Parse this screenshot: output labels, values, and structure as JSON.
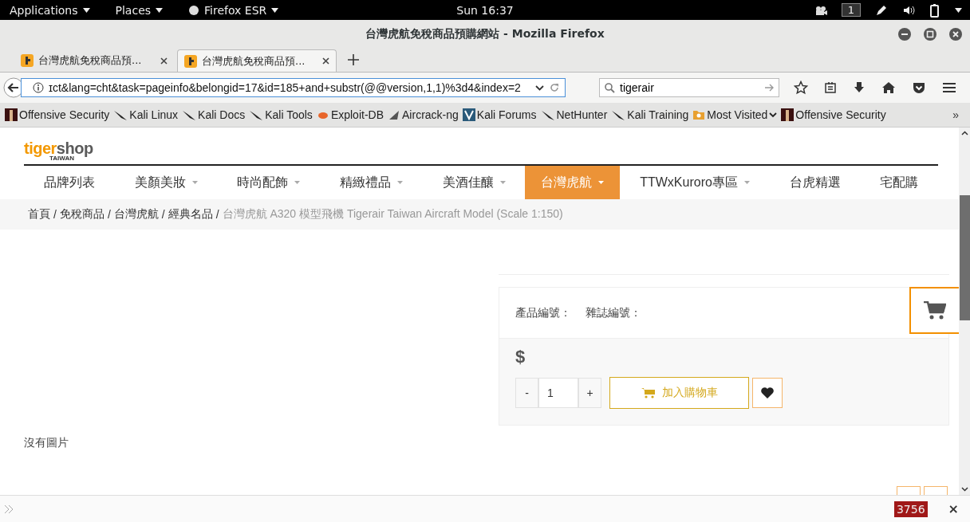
{
  "system_bar": {
    "menus": [
      {
        "label": "Applications",
        "kind": "menu"
      },
      {
        "label": "Places",
        "kind": "menu"
      },
      {
        "label": "Firefox ESR",
        "kind": "app"
      }
    ],
    "clock": "Sun 16:37",
    "workspace": "1"
  },
  "window": {
    "title": "台灣虎航免稅商品預購網站 - Mozilla Firefox"
  },
  "tabs": [
    {
      "label": "台灣虎航免稅商品預...",
      "selected": false
    },
    {
      "label": "台灣虎航免稅商品預...",
      "selected": true
    }
  ],
  "address_bar": {
    "value": "ɪct&lang=cht&task=pageinfo&belongid=17&id=185+and+substr(@@version,1,1)%3d4&index=2"
  },
  "search": {
    "value": "tigerair"
  },
  "bookmarks": [
    {
      "label": "Offensive Security",
      "kind": "offsec"
    },
    {
      "label": "Kali Linux",
      "kind": "kali"
    },
    {
      "label": "Kali Docs",
      "kind": "kali"
    },
    {
      "label": "Kali Tools",
      "kind": "kali"
    },
    {
      "label": "Exploit-DB",
      "kind": "exploit"
    },
    {
      "label": "Aircrack-ng",
      "kind": "aircrack"
    },
    {
      "label": "Kali Forums",
      "kind": "forums"
    },
    {
      "label": "NetHunter",
      "kind": "kali"
    },
    {
      "label": "Kali Training",
      "kind": "kali"
    },
    {
      "label": "Most Visited",
      "kind": "folder"
    },
    {
      "label": "Offensive Security",
      "kind": "offsec"
    }
  ],
  "bookmarks_overflow": "»",
  "site": {
    "logo": {
      "first": "tiger",
      "second": "shop",
      "subtitle": "TAIWAN"
    },
    "nav": [
      {
        "label": "品牌列表",
        "dropdown": false,
        "selected": false
      },
      {
        "label": "美顏美妝",
        "dropdown": true,
        "selected": false
      },
      {
        "label": "時尚配飾",
        "dropdown": true,
        "selected": false
      },
      {
        "label": "精緻禮品",
        "dropdown": true,
        "selected": false
      },
      {
        "label": "美酒佳釀",
        "dropdown": true,
        "selected": false
      },
      {
        "label": "台灣虎航",
        "dropdown": true,
        "selected": true
      },
      {
        "label": "TTWxKuroro專區",
        "dropdown": true,
        "selected": false
      },
      {
        "label": "台虎精選",
        "dropdown": false,
        "selected": false
      },
      {
        "label": "宅配購",
        "dropdown": false,
        "selected": false
      }
    ],
    "breadcrumb": [
      {
        "label": "首頁",
        "separator": "/"
      },
      {
        "label": "免稅商品",
        "separator": "/"
      },
      {
        "label": "台灣虎航",
        "separator": "/"
      },
      {
        "label": "經典名品",
        "separator": "/"
      },
      {
        "label": "台灣虎航 A320 模型飛機 Tigerair Taiwan Aircraft Model (Scale 1:150)"
      }
    ],
    "product": {
      "no_image": "沒有圖片",
      "codes": [
        "產品編號：",
        "雜誌編號："
      ],
      "price": "$",
      "quantity": {
        "minus": "-",
        "value": "1",
        "plus": "+"
      },
      "add_to_cart": "加入購物車"
    }
  },
  "status_bar": {
    "counter": "3756",
    "close": "×"
  }
}
